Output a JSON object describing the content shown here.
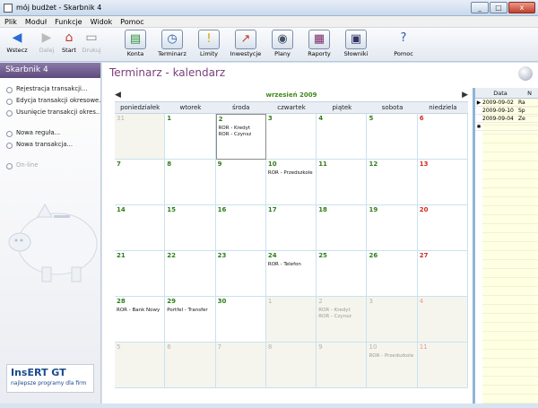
{
  "window": {
    "title": "mój budżet - Skarbnik 4",
    "controls": [
      "_",
      "□",
      "x"
    ]
  },
  "menu": [
    "Plik",
    "Moduł",
    "Funkcje",
    "Widok",
    "Pomoc"
  ],
  "toolbar": {
    "nav": [
      {
        "label": "Wstecz",
        "icon": "back-arrow-icon",
        "glyph": "◀",
        "enabled": true,
        "color": "#2a6bd6"
      },
      {
        "label": "Dalej",
        "icon": "forward-arrow-icon",
        "glyph": "▶",
        "enabled": false,
        "color": "#bbbbbb"
      },
      {
        "label": "Start",
        "icon": "home-icon",
        "glyph": "⌂",
        "enabled": true,
        "color": "#c0392b"
      },
      {
        "label": "Drukuj",
        "icon": "print-icon",
        "glyph": "▭",
        "enabled": false,
        "color": "#888888"
      }
    ],
    "modules": [
      {
        "label": "Konta",
        "icon": "accounts-icon",
        "glyph": "▤",
        "color": "#2f8f3a"
      },
      {
        "label": "Terminarz",
        "icon": "calendar-icon",
        "glyph": "◷",
        "color": "#2a5aa8"
      },
      {
        "label": "Limity",
        "icon": "warning-icon",
        "glyph": "!",
        "color": "#d4a000"
      },
      {
        "label": "Inwestycje",
        "icon": "investment-chart-icon",
        "glyph": "↗",
        "color": "#c0392b"
      },
      {
        "label": "Plany",
        "icon": "plans-icon",
        "glyph": "◉",
        "color": "#445566"
      },
      {
        "label": "Raporty",
        "icon": "reports-icon",
        "glyph": "▦",
        "color": "#7a2a6a"
      },
      {
        "label": "Słowniki",
        "icon": "dictionary-icon",
        "glyph": "▣",
        "color": "#333366"
      },
      {
        "label": "Pomoc",
        "icon": "help-icon",
        "glyph": "?",
        "color": "#2a5aa8"
      }
    ]
  },
  "sidebar": {
    "header": "Skarbnik 4",
    "groups": [
      [
        "Rejestracja transakcji...",
        "Edycja transakcji okresowe...",
        "Usunięcie transakcji okres..."
      ],
      [
        "Nowa reguła...",
        "Nowa transakcja..."
      ]
    ],
    "status": "On-line",
    "logo": {
      "brand": "InsERT GT",
      "tagline": "najlepsze programy dla firm"
    }
  },
  "main": {
    "title": "Terminarz - kalendarz"
  },
  "calendar": {
    "month_label": "wrzesień 2009",
    "weekdays": [
      "poniedziałek",
      "wtorek",
      "środa",
      "czwartek",
      "piątek",
      "sobota",
      "niedziela"
    ],
    "days": [
      {
        "day": "31",
        "other": true,
        "events": []
      },
      {
        "day": "1",
        "events": []
      },
      {
        "day": "2",
        "today": true,
        "events": [
          "ROR - Kredyt",
          "ROR - Czynsz"
        ]
      },
      {
        "day": "3",
        "events": []
      },
      {
        "day": "4",
        "events": []
      },
      {
        "day": "5",
        "events": []
      },
      {
        "day": "6",
        "sun": true,
        "events": []
      },
      {
        "day": "7",
        "events": []
      },
      {
        "day": "8",
        "events": []
      },
      {
        "day": "9",
        "events": []
      },
      {
        "day": "10",
        "events": [
          "ROR - Przedszkole"
        ]
      },
      {
        "day": "11",
        "events": []
      },
      {
        "day": "12",
        "events": []
      },
      {
        "day": "13",
        "sun": true,
        "events": []
      },
      {
        "day": "14",
        "events": []
      },
      {
        "day": "15",
        "events": []
      },
      {
        "day": "16",
        "events": []
      },
      {
        "day": "17",
        "events": []
      },
      {
        "day": "18",
        "events": []
      },
      {
        "day": "19",
        "events": []
      },
      {
        "day": "20",
        "sun": true,
        "events": []
      },
      {
        "day": "21",
        "events": []
      },
      {
        "day": "22",
        "events": []
      },
      {
        "day": "23",
        "events": []
      },
      {
        "day": "24",
        "events": [
          "ROR - Telefon"
        ]
      },
      {
        "day": "25",
        "events": []
      },
      {
        "day": "26",
        "events": []
      },
      {
        "day": "27",
        "sun": true,
        "events": []
      },
      {
        "day": "28",
        "events": [
          "ROR - Bank Nowy"
        ]
      },
      {
        "day": "29",
        "events": [
          "Portfel - Transfer"
        ]
      },
      {
        "day": "30",
        "events": []
      },
      {
        "day": "1",
        "other": true,
        "events": []
      },
      {
        "day": "2",
        "other": true,
        "events": [
          "ROR - Kredyt",
          "ROR - Czynsz"
        ]
      },
      {
        "day": "3",
        "other": true,
        "events": []
      },
      {
        "day": "4",
        "other": true,
        "sun": true,
        "events": []
      },
      {
        "day": "5",
        "other": true,
        "events": []
      },
      {
        "day": "6",
        "other": true,
        "events": []
      },
      {
        "day": "7",
        "other": true,
        "events": []
      },
      {
        "day": "8",
        "other": true,
        "events": []
      },
      {
        "day": "9",
        "other": true,
        "events": []
      },
      {
        "day": "10",
        "other": true,
        "events": [
          "ROR - Przedszkole"
        ]
      },
      {
        "day": "11",
        "other": true,
        "sun": true,
        "events": []
      }
    ]
  },
  "panel": {
    "columns": [
      "Data",
      "N"
    ],
    "rows": [
      {
        "marker": "▶",
        "date": "2009-09-02",
        "n": "Ra"
      },
      {
        "marker": "",
        "date": "2009-09-10",
        "n": "Sp"
      },
      {
        "marker": "",
        "date": "2009-09-04",
        "n": "Ze"
      },
      {
        "marker": "✱",
        "date": "",
        "n": ""
      }
    ]
  }
}
